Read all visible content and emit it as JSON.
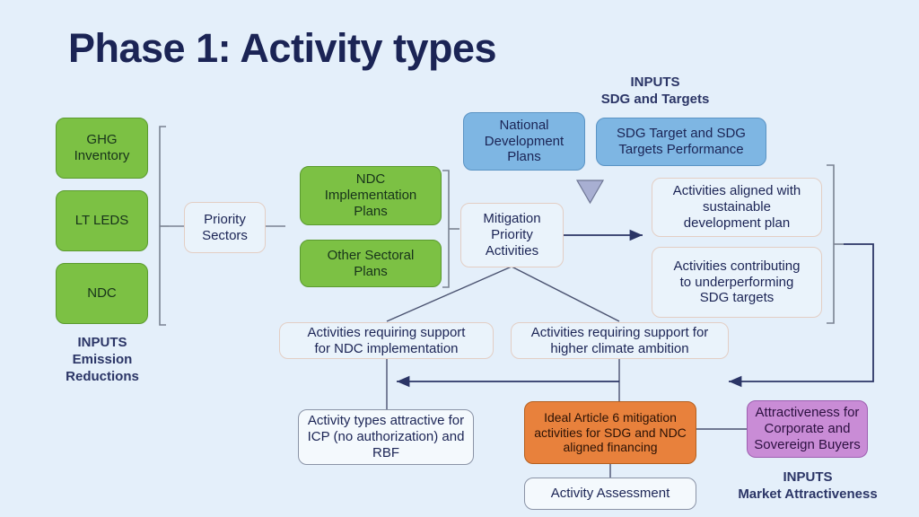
{
  "slide": {
    "title": "Phase 1: Activity types",
    "background_color": "#e4effa",
    "title_color": "#1b2455"
  },
  "palette": {
    "green": "#7cc144",
    "blue": "#7eb6e3",
    "orange": "#e8813c",
    "purple": "#c98cd6",
    "pale": "#eaf3fb",
    "line": "#2b3566",
    "bracket": "#7a8292",
    "triangle": "#a8afd2"
  },
  "inputs_emission_reductions": {
    "boxes": [
      {
        "label": "GHG\nInventory"
      },
      {
        "label": "LT LEDS"
      },
      {
        "label": "NDC"
      }
    ],
    "caption_line1": "INPUTS",
    "caption_line2": "Emission",
    "caption_line3": "Reductions"
  },
  "priority_sectors": {
    "label": "Priority\nSectors"
  },
  "plans": {
    "boxes": [
      {
        "label": "NDC\nImplementation\nPlans"
      },
      {
        "label": "Other Sectoral\nPlans"
      }
    ]
  },
  "mitigation": {
    "label": "Mitigation\nPriority\nActivities"
  },
  "inputs_sdg": {
    "caption_line1": "INPUTS",
    "caption_line2": "SDG and Targets",
    "boxes": [
      {
        "label": "National\nDevelopment\nPlans"
      },
      {
        "label": "SDG Target and SDG\nTargets Performance"
      }
    ]
  },
  "aligned_activities": {
    "boxes": [
      {
        "label": "Activities aligned with\nsustainable\ndevelopment plan"
      },
      {
        "label": "Activities contributing\nto underperforming\nSDG targets"
      }
    ]
  },
  "support_activities": {
    "boxes": [
      {
        "label": "Activities requiring support\nfor NDC implementation"
      },
      {
        "label": "Activities requiring support for\nhigher climate ambition"
      }
    ]
  },
  "outcomes": {
    "icp_rbf": "Activity types attractive for\nICP (no authorization) and\nRBF",
    "ideal_article6": "Ideal Article 6 mitigation\nactivities for SDG and NDC\naligned financing",
    "activity_assessment": "Activity Assessment"
  },
  "inputs_market": {
    "box_label": "Attractiveness for\nCorporate and\nSovereign Buyers",
    "caption_line1": "INPUTS",
    "caption_line2": "Market Attractiveness"
  }
}
